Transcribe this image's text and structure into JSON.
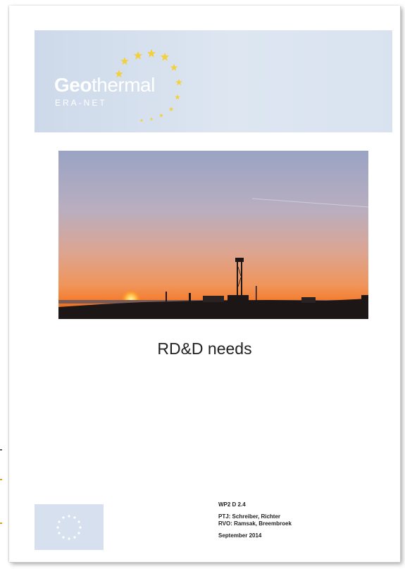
{
  "logo": {
    "geo_bold": "Geo",
    "geo_light": "thermal",
    "subtitle": "ERA-NET",
    "icon": "star-arc-icon"
  },
  "cover_photo": {
    "icon": "drilling-rig-sunset-photo"
  },
  "title": "RD&D needs",
  "meta": {
    "work_package": "WP2 D 2.4",
    "authors_ptj": "PTJ: Schreiber, Richter",
    "authors_rvo": "RVO: Ramsak, Breembroek",
    "date": "September 2014"
  },
  "eu_flag": {
    "icon": "eu-stars-flag-icon"
  },
  "colors": {
    "header_band": "#d6e0ee",
    "star_yellow": "#f3d03e",
    "logo_text": "#ffffff"
  }
}
